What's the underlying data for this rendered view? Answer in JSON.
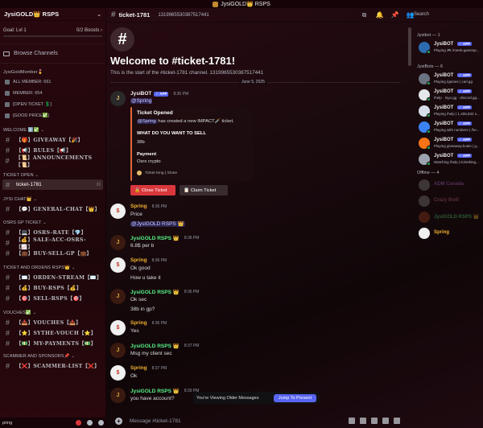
{
  "window": {
    "title": "JysiGOLD👑 RSPS"
  },
  "sidebar": {
    "server_name": "JysiGOLD👑 RSPS",
    "goal": {
      "label": "Goal: Lvl 1",
      "boosts": "0/2 Boosts",
      "boosts_chevron": "›"
    },
    "browse": "Browse Channels",
    "categories": [
      {
        "label": "JysiGoldMember🎖️"
      },
      {
        "label": "WELCOME ℹ️✅"
      },
      {
        "label": "TICKET OPEN"
      },
      {
        "label": "JYSI CHAT👑"
      },
      {
        "label": "OSRS GP TICKET"
      },
      {
        "label": "TICKET AND ORDENS RSPS👑"
      },
      {
        "label": "VOUCHES✅"
      },
      {
        "label": "SCAMMER AND SPONSORS📌"
      }
    ],
    "stats": [
      "ALL MEMBER: 661",
      "MEMBER: 654",
      "[OPEN TICKET 💲]",
      "[GOOD PRICE✅]"
    ],
    "welcome_channels": [
      "【🎁】GIVEAWAY【🎉】",
      "【📢】RULES【📢】",
      "【📜】ANNOUNCEMENTS【📜】"
    ],
    "ticket_channels": [
      "ticket-1781"
    ],
    "chat_channels": [
      "【💬】GENERAL-CHAT【👑】"
    ],
    "gp_channels": [
      "【💻】OSRS-RATE【💎】",
      "【💰】SALE-ACC-OSRS-【📈】",
      "【💼】BUY-SELL-GP【💼】"
    ],
    "rsps_channels": [
      "【✉️】ORDEN-STREAM【✉️】",
      "【💰】BUY-RSPS【💰】",
      "【🎯】SELL-RSPS【🎯】"
    ],
    "vouch_channels": [
      "【📥】VOUCHES【📥】",
      "【⭐】SYTHE-VOUCH【⭐】",
      "【💵】MY-PAYMENTS【💵】"
    ],
    "scam_channels": [
      "【❌】SCAMMER-LIST【❌】"
    ],
    "user": "pring"
  },
  "header": {
    "channel": "ticket-1781",
    "channel_id": "1319965530387517441",
    "search_placeholder": "Search"
  },
  "chat": {
    "welcome_title": "Welcome to #ticket-1781!",
    "welcome_sub": "This is the start of the #ticket-1781 channel. 1319965530387517441",
    "date": "June 5, 2025",
    "bot_msg": {
      "author": "JysiBOT",
      "tag": "✓ APP",
      "time": "8:35 PM",
      "mention": "@Spring",
      "embed": {
        "title": "Ticket Opened",
        "line_mention": "@Spring",
        "line": " has created a new IMPACT🗡️ ticket.",
        "q1": "WHAT DO YOU WANT TO SELL",
        "a1": "38b",
        "q2": "Payment",
        "a2": "Osrs crypto",
        "footer": "Ticket King | /close"
      },
      "buttons": {
        "close": "🔒 Close Ticket",
        "claim": "📋 Claim Ticket"
      }
    },
    "messages": [
      {
        "author": "Spring",
        "time": "8:36 PM",
        "lines": [
          "Price"
        ],
        "mention": "@JysiGOLD RSPS 👑"
      },
      {
        "author": "JysiGOLD RSPS 👑",
        "time": "8:36 PM",
        "lines": [
          "6.8$ per b"
        ]
      },
      {
        "author": "Spring",
        "time": "8:36 PM",
        "lines": [
          "Ok good",
          "How u take it"
        ]
      },
      {
        "author": "JysiGOLD RSPS 👑",
        "time": "8:36 PM",
        "lines": [
          "Ok sec",
          "38b in gp?"
        ]
      },
      {
        "author": "Spring",
        "time": "8:36 PM",
        "lines": [
          "Yes"
        ]
      },
      {
        "author": "JysiGOLD RSPS 👑",
        "time": "8:37 PM",
        "lines": [
          "Msg my client sec"
        ]
      },
      {
        "author": "Spring",
        "time": "8:37 PM",
        "lines": [
          "Ok"
        ]
      },
      {
        "author": "JysiGOLD RSPS 👑",
        "time": "8:39 PM",
        "lines": [
          "you have account?"
        ]
      }
    ],
    "older_banner": "You're Viewing Older Messages",
    "jump": "Jump To Present",
    "composer_placeholder": "Message #ticket-1781"
  },
  "members": {
    "groups": [
      "Jysibot — 1",
      "JysiBots — 6",
      "Offline — 4"
    ],
    "online": [
      {
        "name": "JysiBOT",
        "tag": "✓ APP",
        "status": "Playing 🎮 /meek-gamesp..."
      },
      {
        "name": "JysiBOT",
        "tag": "✓ APP",
        "status": "Playing /games | carl.gg"
      },
      {
        "name": "JysiBOT",
        "tag": "✓ APP",
        "status": "/help · loyo.gg · discord.gg..."
      },
      {
        "name": "JysiBOT",
        "tag": "✓ APP",
        "status": "Playing /help | 1,406,832 s..."
      },
      {
        "name": "JysiBOT",
        "tag": "✓ APP",
        "status": "Playing with numbers | /he..."
      },
      {
        "name": "JysiBOT",
        "tag": "✓ APP",
        "status": "Playing giveaway.boats | g..."
      },
      {
        "name": "JysiBOT",
        "tag": "✓ APP",
        "status": "Watching /help | ticketking..."
      }
    ],
    "offline": [
      "ADM Canada",
      "Crazy BoiII",
      "JysiGOLD RSPS 👑",
      "Spring"
    ]
  }
}
